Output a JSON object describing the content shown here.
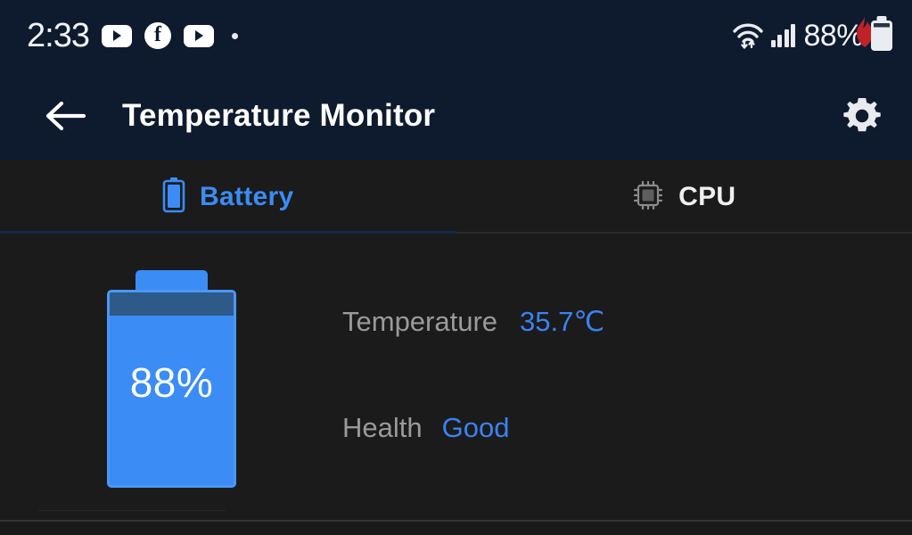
{
  "status_bar": {
    "clock": "2:33",
    "icons": [
      "youtube-icon",
      "facebook-icon",
      "youtube-icon",
      "dot-indicator"
    ],
    "wifi_icon": "wifi-data-transfer-icon",
    "signal_icon": "cellular-signal-icon",
    "battery_percent": "88%",
    "battery_icon": "battery-icon",
    "flame_icon": "flame-icon",
    "flame_color": "#c0222a",
    "background_color": "#0e1a2e"
  },
  "app_bar": {
    "back_icon": "arrow-left-icon",
    "title": "Temperature Monitor",
    "settings_icon": "gear-icon",
    "background_color": "#0e1a2e"
  },
  "tabs": {
    "items": [
      {
        "id": "battery",
        "label": "Battery",
        "icon": "battery-icon",
        "active": true
      },
      {
        "id": "cpu",
        "label": "CPU",
        "icon": "cpu-chip-icon",
        "active": false
      }
    ],
    "active_color": "#3b8cf5",
    "inactive_color": "#f0f0f0",
    "indicator_color": "#112a4d"
  },
  "battery_panel": {
    "level_label": "88%",
    "level_percent": 88,
    "fill_color": "#3b8cf5",
    "empty_color": "#2d5a88",
    "stats": [
      {
        "label": "Temperature",
        "value": "35.7℃"
      },
      {
        "label": "Health",
        "value": "Good"
      }
    ],
    "label_color": "#9a9a9a",
    "value_color": "#3b82f0"
  }
}
